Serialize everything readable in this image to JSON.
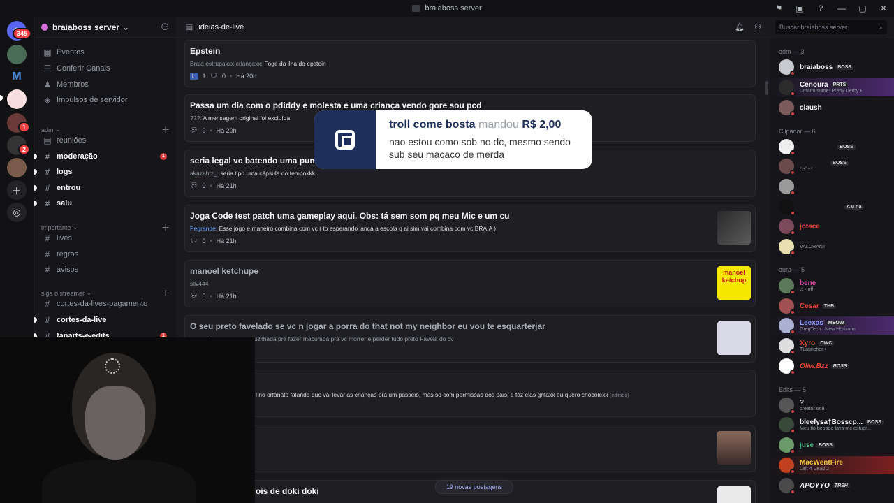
{
  "window": {
    "title": "braiaboss server"
  },
  "rail": {
    "mention_count": "345",
    "badge_1": "1",
    "badge_2": "2"
  },
  "server": {
    "name": "braiaboss server"
  },
  "sidebar": {
    "top_items": [
      {
        "label": "Eventos",
        "icon": "calendar-icon"
      },
      {
        "label": "Conferir Canais",
        "icon": "browse-icon"
      },
      {
        "label": "Membros",
        "icon": "members-icon"
      },
      {
        "label": "Impulsos de servidor",
        "icon": "boost-icon"
      }
    ],
    "categories": [
      {
        "name": "adm",
        "channels": [
          {
            "label": "reuniões",
            "icon": "forum-icon",
            "bold": false
          },
          {
            "label": "moderação",
            "bold": true,
            "badge": "1"
          },
          {
            "label": "logs",
            "bold": true
          },
          {
            "label": "entrou",
            "bold": true
          },
          {
            "label": "saiu",
            "bold": true
          }
        ]
      },
      {
        "name": "importante",
        "channels": [
          {
            "label": "lives",
            "bold": false
          },
          {
            "label": "regras",
            "bold": false
          },
          {
            "label": "avisos",
            "bold": false
          }
        ]
      },
      {
        "name": "siga o streamer",
        "channels": [
          {
            "label": "cortes-da-lives-pagamento",
            "bold": false
          },
          {
            "label": "cortes-da-live",
            "bold": true
          },
          {
            "label": "fanarts-e-edits",
            "bold": true,
            "badge": "1"
          }
        ]
      }
    ]
  },
  "channel": {
    "name": "ideias-de-live",
    "search_placeholder": "Buscar braiaboss server"
  },
  "posts": [
    {
      "title": "Epstein",
      "author": "Braia estrupaxxx criançaxx:",
      "preview": "Foge da ilha do epstein",
      "reactions": "1",
      "reaction_emoji": "L",
      "replies": "0",
      "time": "Há 20h"
    },
    {
      "title": "Passa um dia com o pdiddy e molesta e uma criança vendo gore sou pcd",
      "author": "???:",
      "preview": "A mensagem original foi excluída",
      "replies": "0",
      "time": "Há 20h"
    },
    {
      "title": "seria legal vc batendo uma pun",
      "author": "akazahtz_:",
      "preview": "seria tipo uma cápsula do tempokkk",
      "replies": "0",
      "time": "Há 21h"
    },
    {
      "title": "Joga Code test patch uma gameplay aqui. Obs: tá sem som pq meu Mic e um cu",
      "author": "Pegrande:",
      "preview": "Esse jogo e maneiro combina com vc ( to esperando lança a escola q ai sim vai combina com vc BRAIA )",
      "replies": "0",
      "time": "Há 21h"
    },
    {
      "title": "manoel ketchupe",
      "author": "silv444",
      "preview": "",
      "replies": "0",
      "time": "Há 21h",
      "thumb_text": "manoel ketchup"
    },
    {
      "title": "O seu preto favelado se vc n jogar a porra do that not my neighbor eu vou te esquarterjar",
      "author": "",
      "preview": "• Vou em uma encruzilhada pra fazer macumba pra vc morrer e perder tudo preto Favela do cv"
    },
    {
      "title": "",
      "author": "",
      "preview": "l no orfanato falando que vai levar as crianças pra um passeio, mas só com permissão dos pais, e faz elas gritaxx eu quero chocolexx",
      "edited": "(editado)"
    },
    {
      "title": "",
      "author": "",
      "preview": ""
    },
    {
      "title": "ois de doki doki",
      "author": "",
      "preview": ""
    }
  ],
  "new_posts": "19 novas postagens",
  "donation": {
    "donor": "troll come bosta",
    "verb": "mandou",
    "amount": "R$ 2,00",
    "message": "nao estou como sob no dc, mesmo sendo sub seu macaco de merda"
  },
  "members": {
    "groups": [
      {
        "label": "adm — 3",
        "items": [
          {
            "name": "braiaboss",
            "tag": "BOSS",
            "status": ""
          },
          {
            "name": "Cenoura",
            "tag": "PRTS",
            "status": "Umamusume: Pretty Derby •"
          },
          {
            "name": "claush",
            "tag": "",
            "status": ""
          }
        ]
      },
      {
        "label": "Clipador — 6",
        "items": [
          {
            "name": "",
            "tag": "BOSS",
            "status": ""
          },
          {
            "name": "",
            "tag": "BOSS",
            "status": "*:･ﾟ+*"
          },
          {
            "name": "",
            "tag": "",
            "status": ""
          },
          {
            "name": "",
            "tag": "A u r a",
            "status": ""
          },
          {
            "name": "jotace",
            "tag": "",
            "status": ""
          },
          {
            "name": "",
            "tag": "",
            "status": "VALORANT"
          }
        ]
      },
      {
        "label": "aura — 5",
        "items": [
          {
            "name": "bene",
            "tag": "",
            "status": "♫ • off"
          },
          {
            "name": "Cesar",
            "tag": "THB",
            "status": ""
          },
          {
            "name": "Leexas",
            "tag": "MEOW",
            "status": "GregTech : New Horizons"
          },
          {
            "name": "Xyro",
            "tag": "OWC",
            "status": "TLauncher •"
          },
          {
            "name": "Oliw.Bzz",
            "tag": "BOSS",
            "status": ""
          }
        ]
      },
      {
        "label": "Edits — 5",
        "items": [
          {
            "name": "?",
            "tag": "",
            "status": "creator 669"
          },
          {
            "name": "bleefysa†Bosscp...",
            "tag": "BOSS",
            "status": "Meu tio bebado tava me estupr..."
          },
          {
            "name": "juse",
            "tag": "BOSS",
            "status": ""
          },
          {
            "name": "MacWentFire",
            "tag": "",
            "status": "Left 4 Dead 2"
          },
          {
            "name": "APOYYO",
            "tag": "TRSH",
            "status": ""
          }
        ]
      }
    ]
  },
  "colors": {
    "accent": "#5865f2",
    "unread_badge": "#f23f43",
    "link": "#6ca2ff",
    "donation_brand": "#1d2f5a"
  }
}
